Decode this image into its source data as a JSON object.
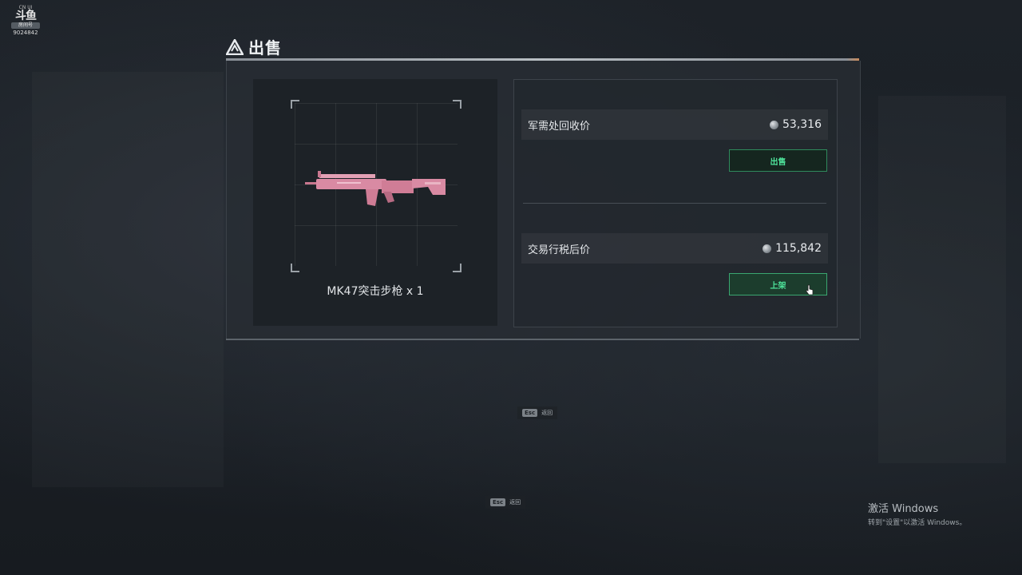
{
  "watermark": {
    "top": "CN UI",
    "logo": "斗鱼",
    "tag": "房间号",
    "room_id": "9024842"
  },
  "dialog": {
    "title": "出售"
  },
  "item": {
    "name": "MK47突击步枪 x 1"
  },
  "recycle": {
    "label": "军需处回收价",
    "price": "53,316",
    "button": "出售"
  },
  "market": {
    "label": "交易行税后价",
    "price": "115,842",
    "button": "上架"
  },
  "esc_hints": [
    {
      "key": "Esc",
      "label": "返回"
    },
    {
      "key": "Esc",
      "label": "返回"
    }
  ],
  "os_notice": {
    "title": "激活 Windows",
    "subtitle": "转到\"设置\"以激活 Windows。"
  },
  "colors": {
    "accent_green": "#4ee29a",
    "coin": "#9aa1a7",
    "weapon_skin": "#d98aa3"
  }
}
